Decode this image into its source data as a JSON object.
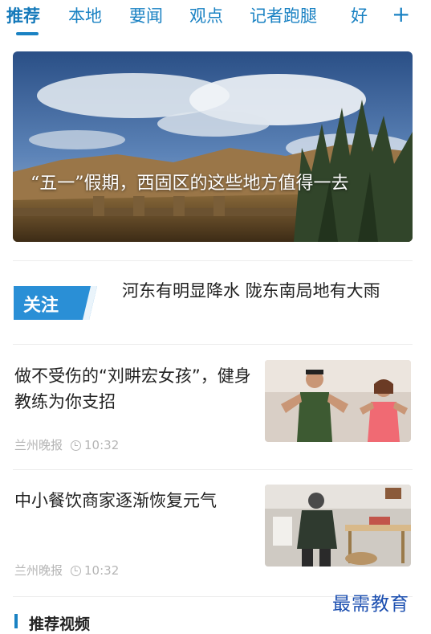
{
  "tabs": [
    "推荐",
    "本地",
    "要闻",
    "观点",
    "记者跑腿",
    "好"
  ],
  "tabs_more_label": "+",
  "banner": {
    "caption": "“五一”假期，西固区的这些地方值得一去"
  },
  "follow": {
    "badge": "关注",
    "title": "河东有明显降水 陇东南局地有大雨"
  },
  "news": [
    {
      "title": "做不受伤的“刘畊宏女孩”，健身教练为你支招",
      "source": "兰州晚报",
      "time": "10:32"
    },
    {
      "title": "中小餐饮商家逐渐恢复元气",
      "source": "兰州晚报",
      "time": "10:32"
    }
  ],
  "section": {
    "title": "推荐视频"
  },
  "watermark": "最需教育",
  "colors": {
    "accent": "#1a82c3",
    "badge": "#2a8fd6",
    "meta": "#b5b5b5"
  }
}
